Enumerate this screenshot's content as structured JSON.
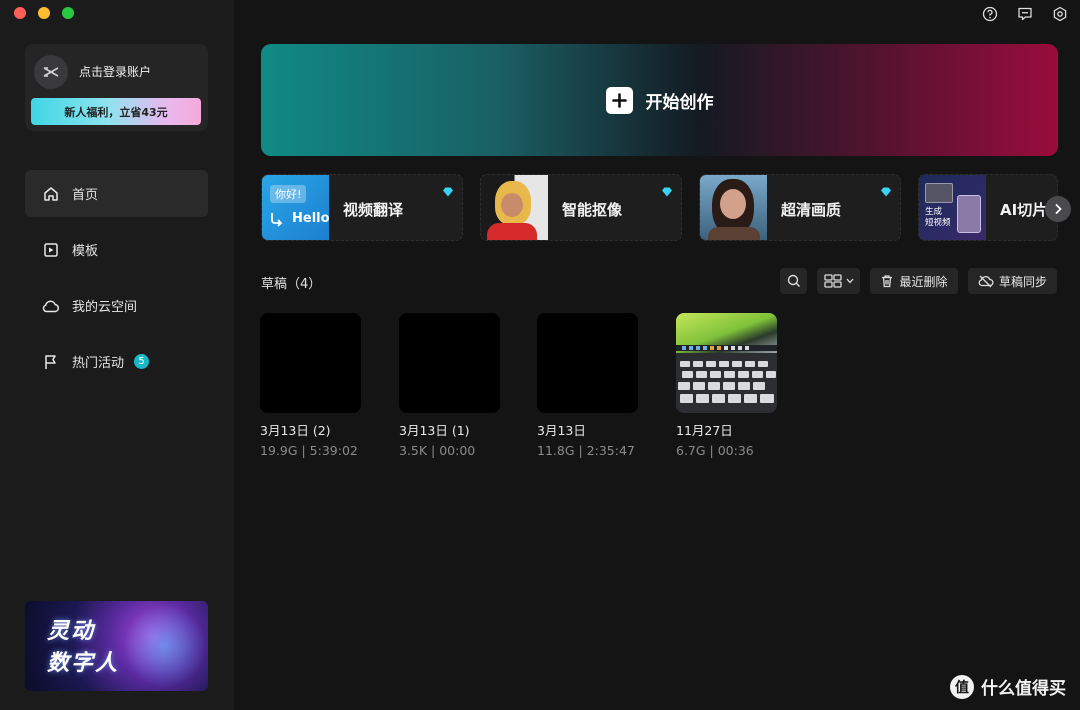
{
  "sidebar": {
    "account": {
      "login_text": "点击登录账户",
      "promo": "新人福利，立省43元"
    },
    "nav": [
      {
        "label": "首页",
        "icon": "home-icon",
        "active": true
      },
      {
        "label": "模板",
        "icon": "template-icon"
      },
      {
        "label": "我的云空间",
        "icon": "cloud-icon"
      },
      {
        "label": "热门活动",
        "icon": "flag-icon",
        "badge": "5"
      }
    ],
    "banner": {
      "line1": "灵动",
      "line2": "数字人"
    }
  },
  "topbar": {
    "icons": [
      "help-icon",
      "feedback-icon",
      "settings-icon"
    ]
  },
  "create": {
    "label": "开始创作"
  },
  "features": [
    {
      "label": "视频翻译",
      "thumb_text_1": "你好!",
      "thumb_text_2": "Hello"
    },
    {
      "label": "智能抠像"
    },
    {
      "label": "超清画质"
    },
    {
      "label": "AI切片",
      "thumb_text_1": "生成",
      "thumb_text_2": "短视频"
    }
  ],
  "drafts": {
    "title": "草稿（4）",
    "toolbar": {
      "recent_delete": "最近删除",
      "sync": "草稿同步"
    },
    "items": [
      {
        "name": "3月13日 (2)",
        "meta": "19.9G | 5:39:02"
      },
      {
        "name": "3月13日 (1)",
        "meta": "3.5K | 00:00"
      },
      {
        "name": "3月13日",
        "meta": "11.8G | 2:35:47"
      },
      {
        "name": "11月27日",
        "meta": "6.7G | 00:36"
      }
    ]
  },
  "watermark": {
    "text": "什么值得买",
    "logo": "值"
  },
  "colors": {
    "accent": "#19b7c8",
    "background": "#141414",
    "sidebar": "#1b1b1c"
  }
}
